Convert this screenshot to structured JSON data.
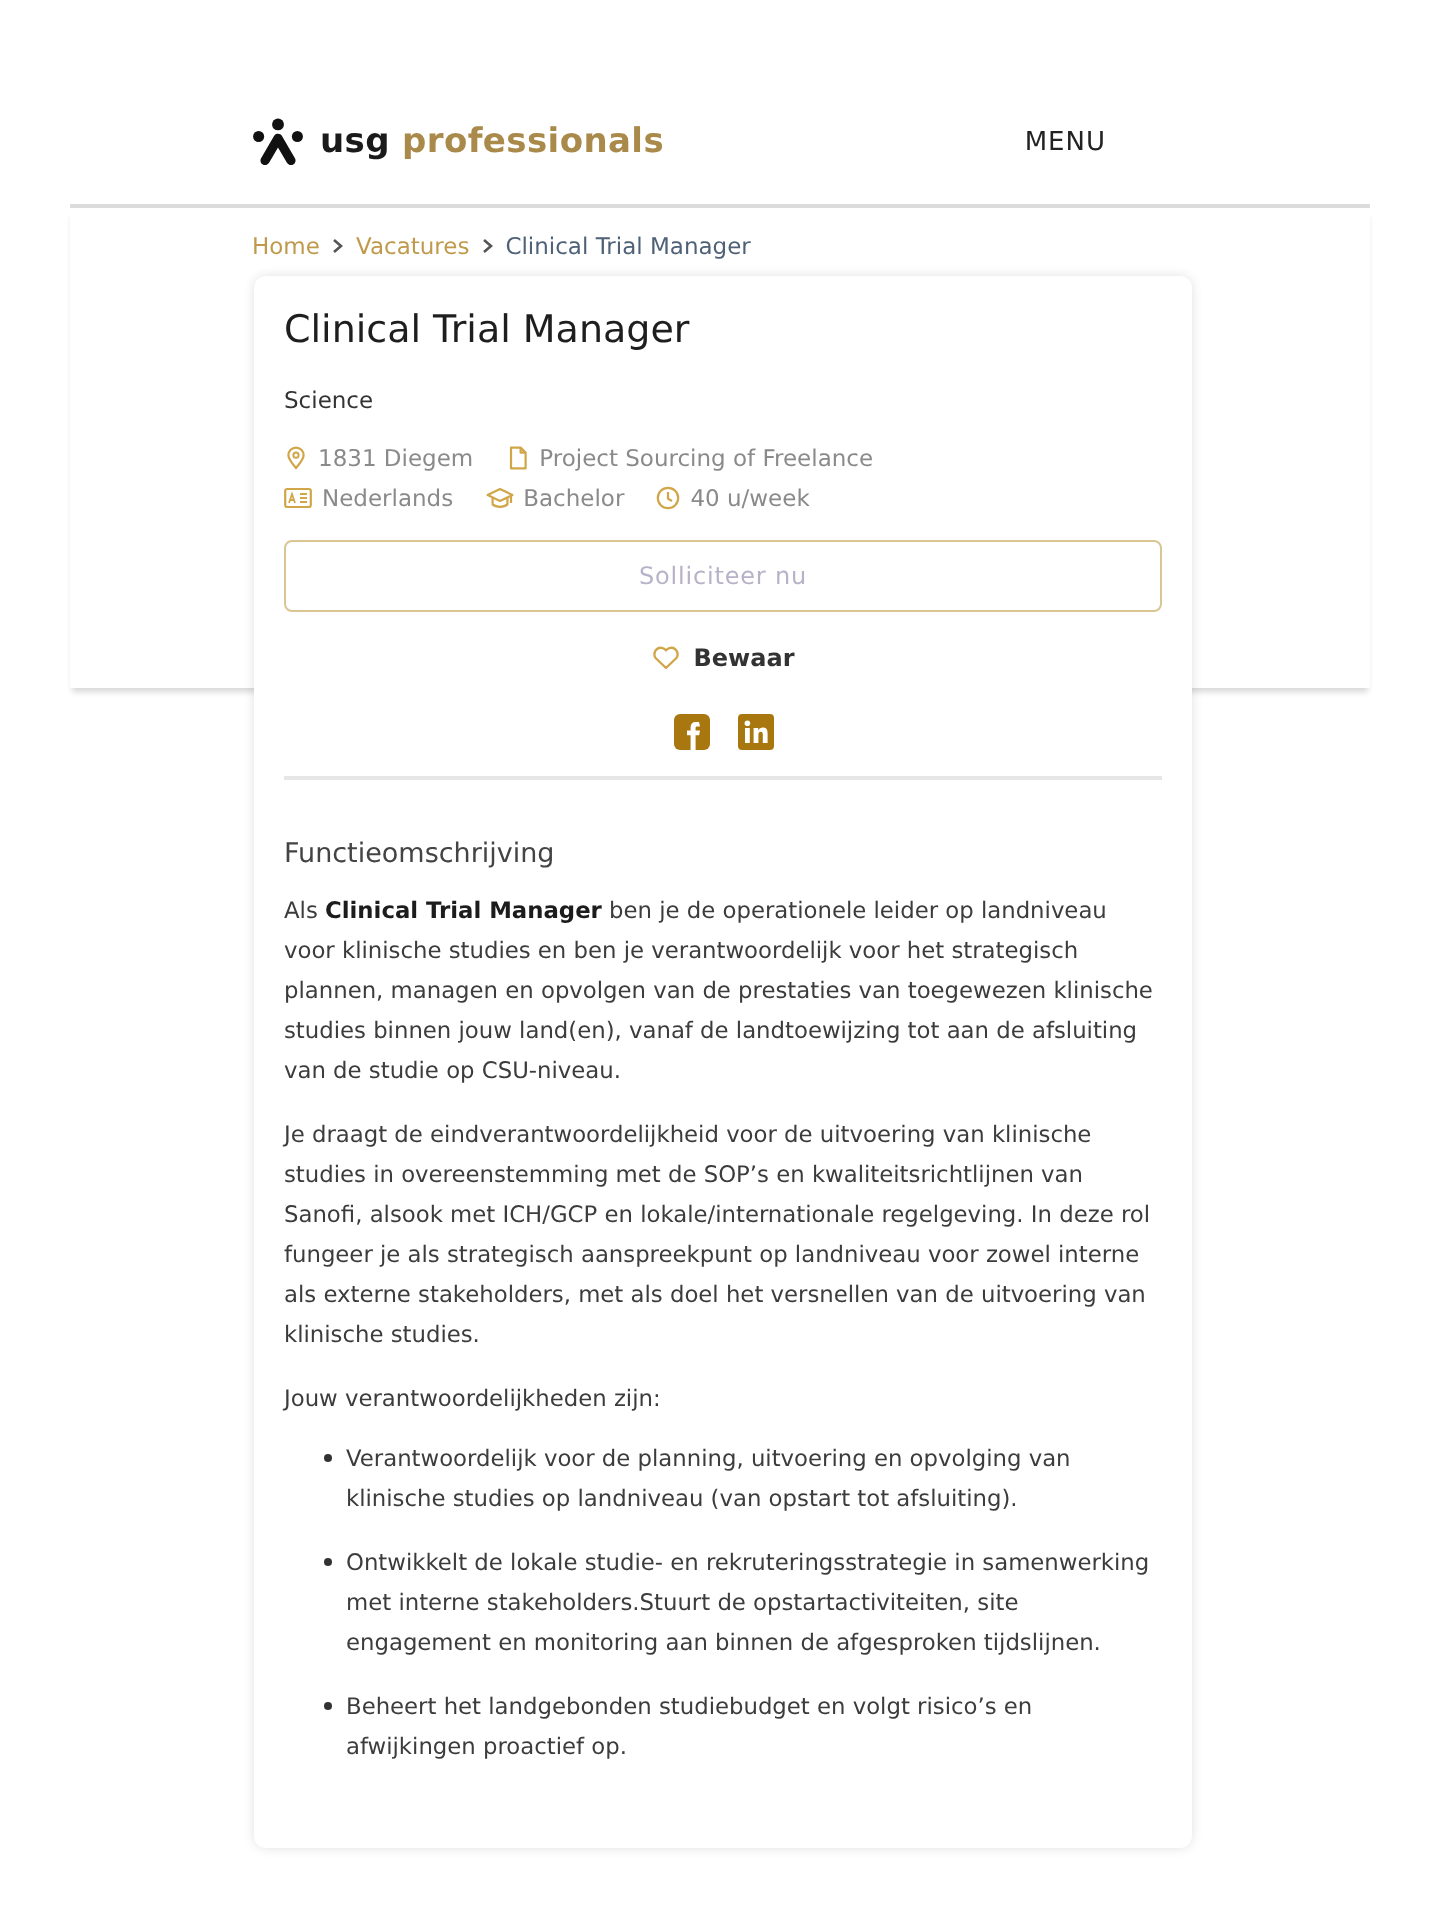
{
  "header": {
    "logo_word_1": "usg",
    "logo_word_2": "professionals",
    "menu": "MENU"
  },
  "breadcrumb": [
    {
      "label": "Home",
      "current": false
    },
    {
      "label": "Vacatures",
      "current": false
    },
    {
      "label": "Clinical Trial Manager",
      "current": true
    }
  ],
  "job": {
    "title": "Clinical Trial Manager",
    "category": "Science",
    "detail_rows": [
      [
        {
          "kind": "location",
          "text": "1831 Diegem"
        },
        {
          "kind": "document",
          "text": "Project Sourcing of Freelance"
        }
      ],
      [
        {
          "kind": "language",
          "text": "Nederlands"
        },
        {
          "kind": "education",
          "text": "Bachelor"
        },
        {
          "kind": "hours",
          "text": "40 u/week"
        }
      ]
    ],
    "apply_button": "Solliciteer nu",
    "save_button": "Bewaar",
    "share": [
      {
        "kind": "facebook"
      },
      {
        "kind": "linkedin"
      }
    ]
  },
  "description": {
    "heading": "Functieomschrijving",
    "paragraphs": [
      "Als **Clinical Trial Manager** ben je de operationele leider op landniveau voor klinische studies en ben je verantwoordelijk voor het strategisch plannen, managen en opvolgen van de prestaties van toegewezen klinische studies binnen jouw land(en), vanaf de landtoewijzing tot aan de afsluiting van de studie op CSU-niveau.",
      "Je draagt de eindverantwoordelijkheid voor de uitvoering van klinische studies in overeenstemming met de SOP’s en kwaliteitsrichtlijnen van Sanofi, alsook met ICH/GCP en lokale/internationale regelgeving. In deze rol fungeer je als strategisch aanspreekpunt op landniveau voor zowel interne als externe stakeholders, met als doel het versnellen van de uitvoering van klinische studies.",
      "Jouw verantwoordelijkheden zijn:"
    ],
    "items": [
      "Verantwoordelijk voor de planning, uitvoering en opvolging van klinische studies op landniveau (van opstart tot afsluiting).",
      "Ontwikkelt de lokale studie- en rekruteringsstrategie in samenwerking met interne stakeholders.Stuurt de opstartactiviteiten, site engagement en monitoring aan binnen de afgesproken tijdslijnen.",
      "Beheert het landgebonden studiebudget en volgt risico’s en afwijkingen proactief op."
    ]
  }
}
